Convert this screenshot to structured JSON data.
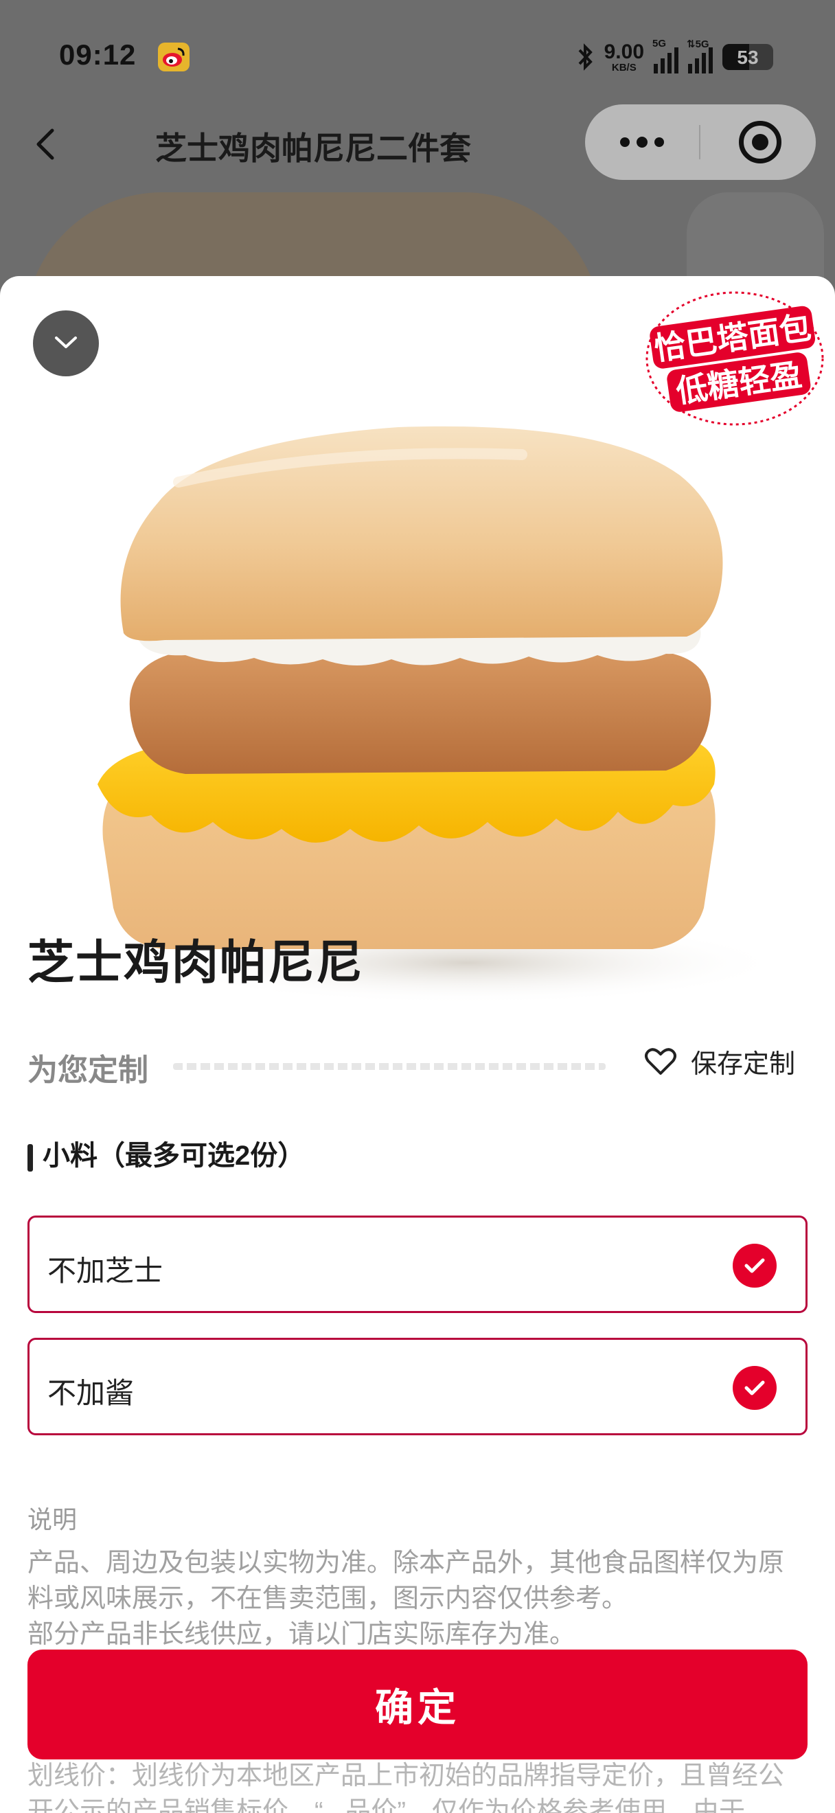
{
  "status_bar": {
    "time": "09:12",
    "net_speed_value": "9.00",
    "net_speed_unit": "KB/S",
    "signal1_tag": "5G",
    "signal2_tag": "⇅5G",
    "battery": "53",
    "battery_level_percent": 53
  },
  "nav": {
    "title": "芝士鸡肉帕尼尼二件套"
  },
  "sheet": {
    "badge_line1": "恰巴塔面包",
    "badge_line2": "低糖轻盈",
    "product_name": "芝士鸡肉帕尼尼",
    "custom_label": "为您定制",
    "save_label": "保存定制",
    "section_title": "小料（最多可选2份）",
    "options": [
      {
        "label": "不加芝士",
        "selected": true
      },
      {
        "label": "不加酱",
        "selected": true
      }
    ],
    "desc_title": "说明",
    "desc_lines": [
      "产品、周边及包装以实物为准。除本产品外，其他食品图样仅为原",
      "料或风味展示，不在售卖范围，图示内容仅供参考。",
      "部分产品非长线供应，请以门店实际库存为准。"
    ],
    "confirm_label": "确定",
    "footer_lines": [
      "划线价：划线价为本地区产品上市初始的品牌指导定价，且曾经公",
      "开公示的产品销售标价，“...品价”，仅作为价格参考使用，由于"
    ]
  },
  "colors": {
    "accent_red": "#e4002b",
    "option_border": "#b8073d",
    "overlay_gray": "#6d6d6d"
  },
  "icons": {
    "back": "chevron-left-icon",
    "more": "more-dots-icon",
    "close_miniapp": "target-icon",
    "collapse": "chevron-down-icon",
    "save": "heart-outline-icon",
    "check": "checkmark-icon"
  }
}
